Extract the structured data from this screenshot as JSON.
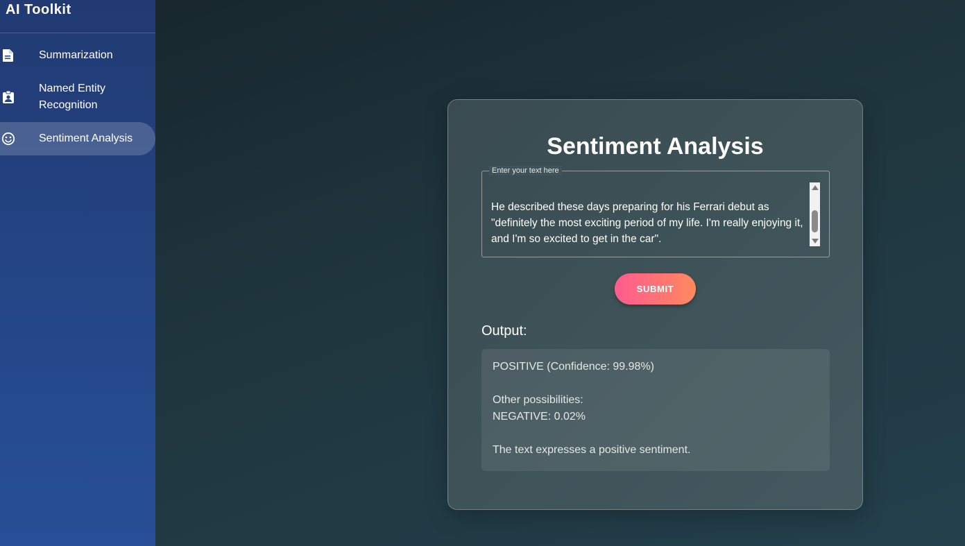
{
  "app": {
    "title": "AI Toolkit"
  },
  "sidebar": {
    "items": [
      {
        "label": "Summarization",
        "icon": "document-icon"
      },
      {
        "label": "Named Entity Recognition",
        "icon": "badge-icon"
      },
      {
        "label": "Sentiment Analysis",
        "icon": "smiley-icon",
        "active": true
      }
    ]
  },
  "main": {
    "title": "Sentiment Analysis",
    "input": {
      "legend": "Enter your text here",
      "value": "He described these days preparing for his Ferrari debut as \"definitely the most exciting period of my life. I'm really enjoying it, and I'm so excited to get in the car\"."
    },
    "submit_label": "SUBMIT",
    "output": {
      "label": "Output:",
      "lines": [
        "POSITIVE (Confidence: 99.98%)",
        "Other possibilities:",
        "NEGATIVE: 0.02%",
        "The text expresses a positive sentiment."
      ]
    }
  },
  "colors": {
    "sidebar": "#244687",
    "accent_start": "#ff5b8f",
    "accent_end": "#ff8a5c"
  }
}
